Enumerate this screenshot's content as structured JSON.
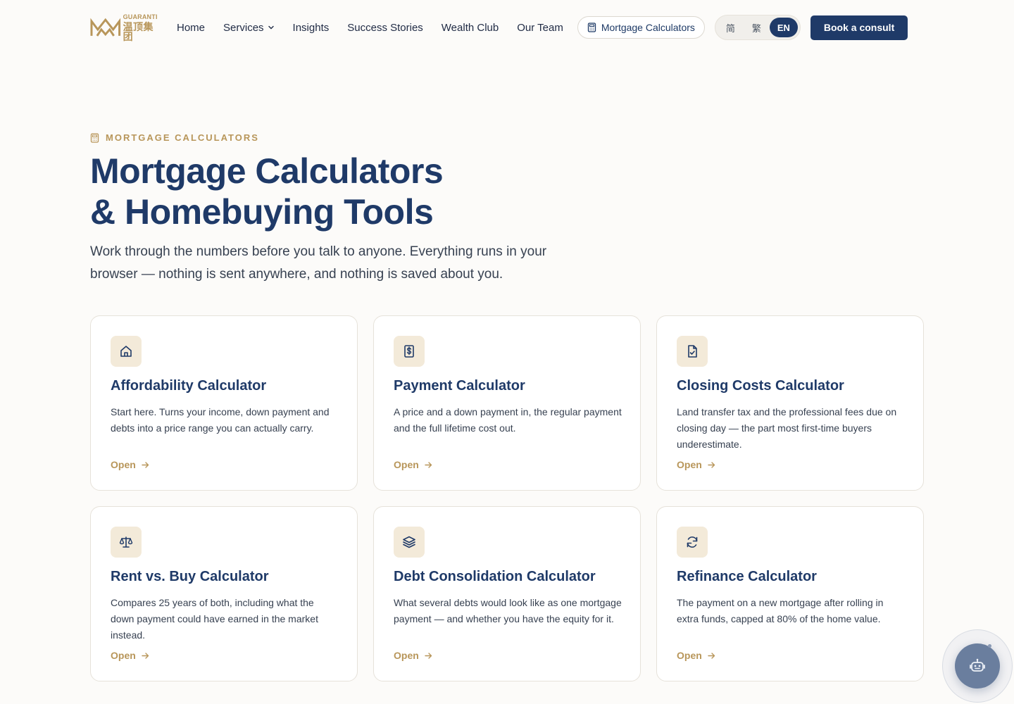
{
  "brand": {
    "logo_en": "GUARANTI",
    "logo_cn": "温顶集团",
    "accent_gold": "#b8965a",
    "navy": "#1f3a68"
  },
  "nav": {
    "items": [
      "Home",
      "Services",
      "Insights",
      "Success Stories",
      "Wealth Club",
      "Our Team"
    ],
    "calculators_pill": "Mortgage Calculators",
    "languages": [
      "简",
      "繁",
      "EN"
    ],
    "active_language": "EN",
    "consult_button": "Book a consult"
  },
  "hero": {
    "eyebrow": "MORTGAGE CALCULATORS",
    "title_line1": "Mortgage Calculators",
    "title_line2": "& Homebuying Tools",
    "subtitle": "Work through the numbers before you talk to anyone. Everything runs in your browser — nothing is sent anywhere, and nothing is saved about you."
  },
  "cards": [
    {
      "icon": "home-icon",
      "title": "Affordability Calculator",
      "description": "Start here. Turns your income, down payment and debts into a price range you can actually carry.",
      "link": "Open"
    },
    {
      "icon": "dollar-receipt-icon",
      "title": "Payment Calculator",
      "description": "A price and a down payment in, the regular payment and the full lifetime cost out.",
      "link": "Open"
    },
    {
      "icon": "file-check-icon",
      "title": "Closing Costs Calculator",
      "description": "Land transfer tax and the professional fees due on closing day — the part most first-time buyers underestimate.",
      "link": "Open"
    },
    {
      "icon": "scale-icon",
      "title": "Rent vs. Buy Calculator",
      "description": "Compares 25 years of both, including what the down payment could have earned in the market instead.",
      "link": "Open"
    },
    {
      "icon": "layers-icon",
      "title": "Debt Consolidation Calculator",
      "description": "What several debts would look like as one mortgage payment — and whether you have the equity for it.",
      "link": "Open"
    },
    {
      "icon": "refresh-icon",
      "title": "Refinance Calculator",
      "description": "The payment on a new mortgage after rolling in extra funds, capped at 80% of the home value.",
      "link": "Open"
    }
  ],
  "chat": {
    "icon": "robot-icon"
  }
}
